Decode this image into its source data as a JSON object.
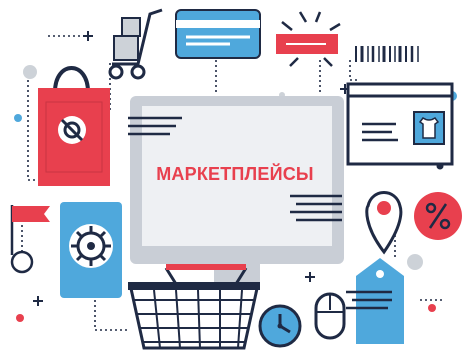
{
  "title": "МАРКЕТПЛЕЙСЫ",
  "colors": {
    "accent": "#e8404e",
    "blue": "#4fa8dc",
    "dark": "#1f2a44",
    "monitor_gray": "#c9ced6",
    "screen": "#eef0f3",
    "dot_gray": "#cdd2d8"
  },
  "icons": [
    "shopping-bag-icon",
    "hand-truck-icon",
    "credit-card-icon",
    "barcode-icon",
    "monitor-icon",
    "browser-window-icon",
    "t-shirt-icon",
    "flag-icon",
    "safe-dial-icon",
    "map-pin-icon",
    "percent-badge-icon",
    "shopping-basket-icon",
    "clock-icon",
    "computer-mouse-icon",
    "price-tag-icon",
    "circle-pin-icon"
  ]
}
